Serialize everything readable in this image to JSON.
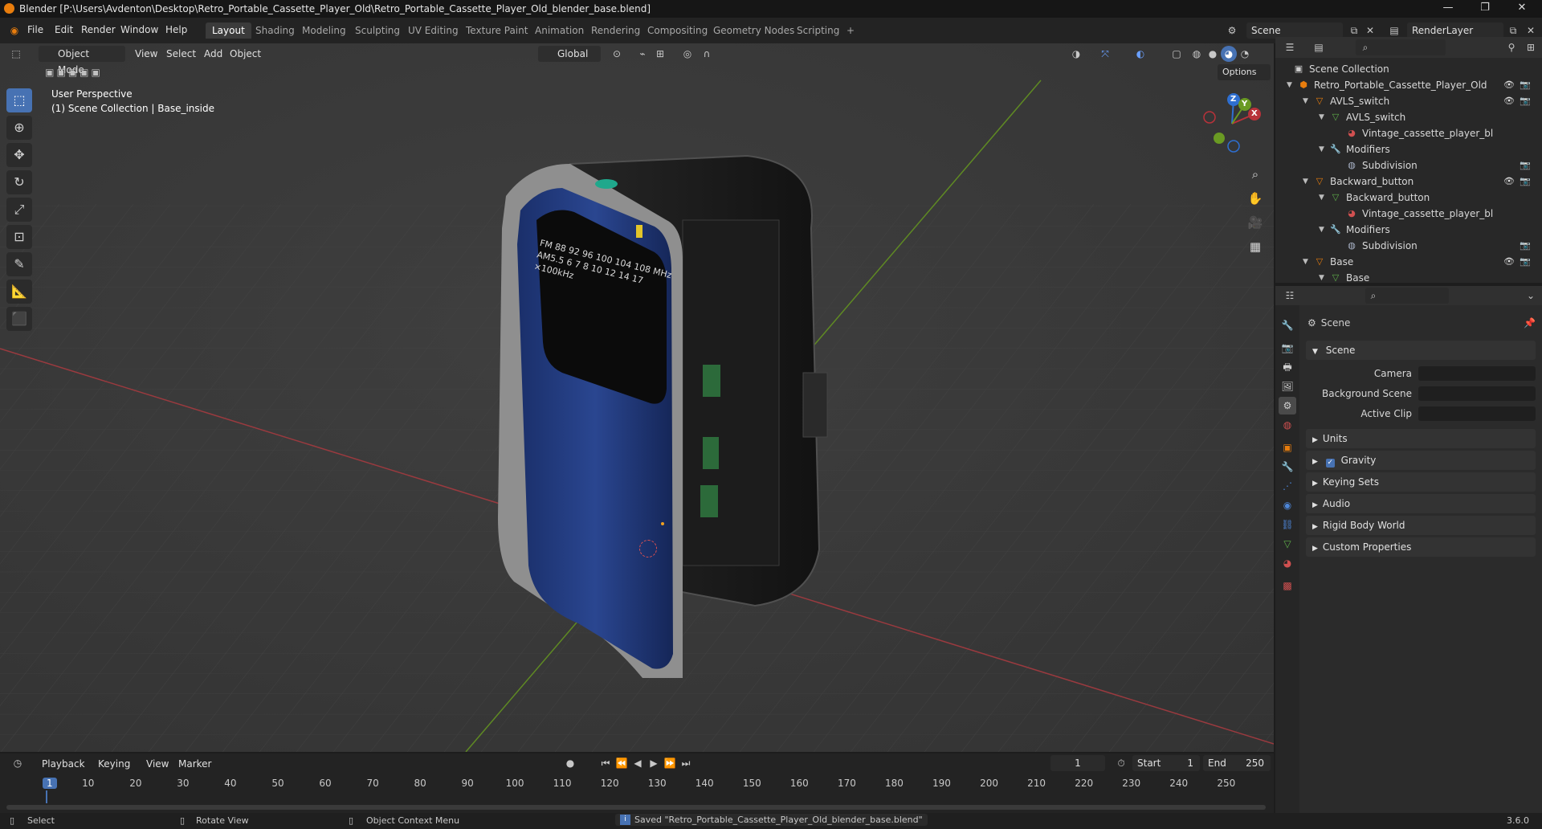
{
  "window": {
    "title": "Blender [P:\\Users\\Avdenton\\Desktop\\Retro_Portable_Cassette_Player_Old\\Retro_Portable_Cassette_Player_Old_blender_base.blend]",
    "minimize": "—",
    "maximize": "❐",
    "close": "✕"
  },
  "menu": {
    "items": [
      "File",
      "Edit",
      "Render",
      "Window",
      "Help"
    ],
    "workspaces": [
      "Layout",
      "Shading",
      "Modeling",
      "Sculpting",
      "UV Editing",
      "Texture Paint",
      "Animation",
      "Rendering",
      "Compositing",
      "Geometry Nodes",
      "Scripting"
    ],
    "add_workspace": "+",
    "scene": "Scene",
    "view_layer": "RenderLayer"
  },
  "viewport": {
    "mode": "Object Mode",
    "menus": [
      "View",
      "Select",
      "Add",
      "Object"
    ],
    "transform_orientation": "Global",
    "options": "Options",
    "perspective": "User Perspective",
    "collection_info": "(1) Scene Collection | Base_inside",
    "device_screen": "FM 88 92 96 100 104 108 MHz AM5.5 6 7 8 10 12 14 17 ×100kHz",
    "axis": {
      "x": "X",
      "y": "Y",
      "z": "Z"
    }
  },
  "outliner": {
    "root": "Scene Collection",
    "rows": [
      {
        "label": "Retro_Portable_Cassette_Player_Old",
        "depth": 1,
        "icon": "collection",
        "vis": true
      },
      {
        "label": "AVLS_switch",
        "depth": 2,
        "icon": "object",
        "vis": true
      },
      {
        "label": "AVLS_switch",
        "depth": 3,
        "icon": "mesh",
        "vis": false
      },
      {
        "label": "Vintage_cassette_player_bl",
        "depth": 4,
        "icon": "material",
        "vis": false
      },
      {
        "label": "Modifiers",
        "depth": 3,
        "icon": "wrench",
        "vis": false
      },
      {
        "label": "Subdivision",
        "depth": 4,
        "icon": "modifier",
        "vis": false,
        "cam": true
      },
      {
        "label": "Backward_button",
        "depth": 2,
        "icon": "object",
        "vis": true
      },
      {
        "label": "Backward_button",
        "depth": 3,
        "icon": "mesh",
        "vis": false
      },
      {
        "label": "Vintage_cassette_player_bl",
        "depth": 4,
        "icon": "material",
        "vis": false
      },
      {
        "label": "Modifiers",
        "depth": 3,
        "icon": "wrench",
        "vis": false
      },
      {
        "label": "Subdivision",
        "depth": 4,
        "icon": "modifier",
        "vis": false,
        "cam": true
      },
      {
        "label": "Base",
        "depth": 2,
        "icon": "object",
        "vis": true
      },
      {
        "label": "Base",
        "depth": 3,
        "icon": "mesh",
        "vis": false
      }
    ]
  },
  "properties": {
    "context": "Scene",
    "panel_scene": "Scene",
    "camera_label": "Camera",
    "background_scene_label": "Background Scene",
    "active_clip_label": "Active Clip",
    "panels": [
      "Units",
      "Gravity",
      "Keying Sets",
      "Audio",
      "Rigid Body World",
      "Custom Properties"
    ]
  },
  "timeline": {
    "menus": [
      "Playback",
      "Keying",
      "View",
      "Marker"
    ],
    "current_frame": "1",
    "start_label": "Start",
    "start": "1",
    "end_label": "End",
    "end": "250",
    "ticks": [
      "1",
      "10",
      "20",
      "30",
      "40",
      "50",
      "60",
      "70",
      "80",
      "90",
      "100",
      "110",
      "120",
      "130",
      "140",
      "150",
      "160",
      "170",
      "180",
      "190",
      "200",
      "210",
      "220",
      "230",
      "240",
      "250"
    ]
  },
  "status": {
    "select": "Select",
    "rotate": "Rotate View",
    "context_menu": "Object Context Menu",
    "message": "Saved \"Retro_Portable_Cassette_Player_Old_blender_base.blend\"",
    "version": "3.6.0"
  },
  "colors": {
    "accent": "#4772b3",
    "blender_orange": "#e87d0d",
    "axis_x": "#b8323a",
    "axis_y": "#6a9a23",
    "axis_z": "#2e6fd1"
  }
}
